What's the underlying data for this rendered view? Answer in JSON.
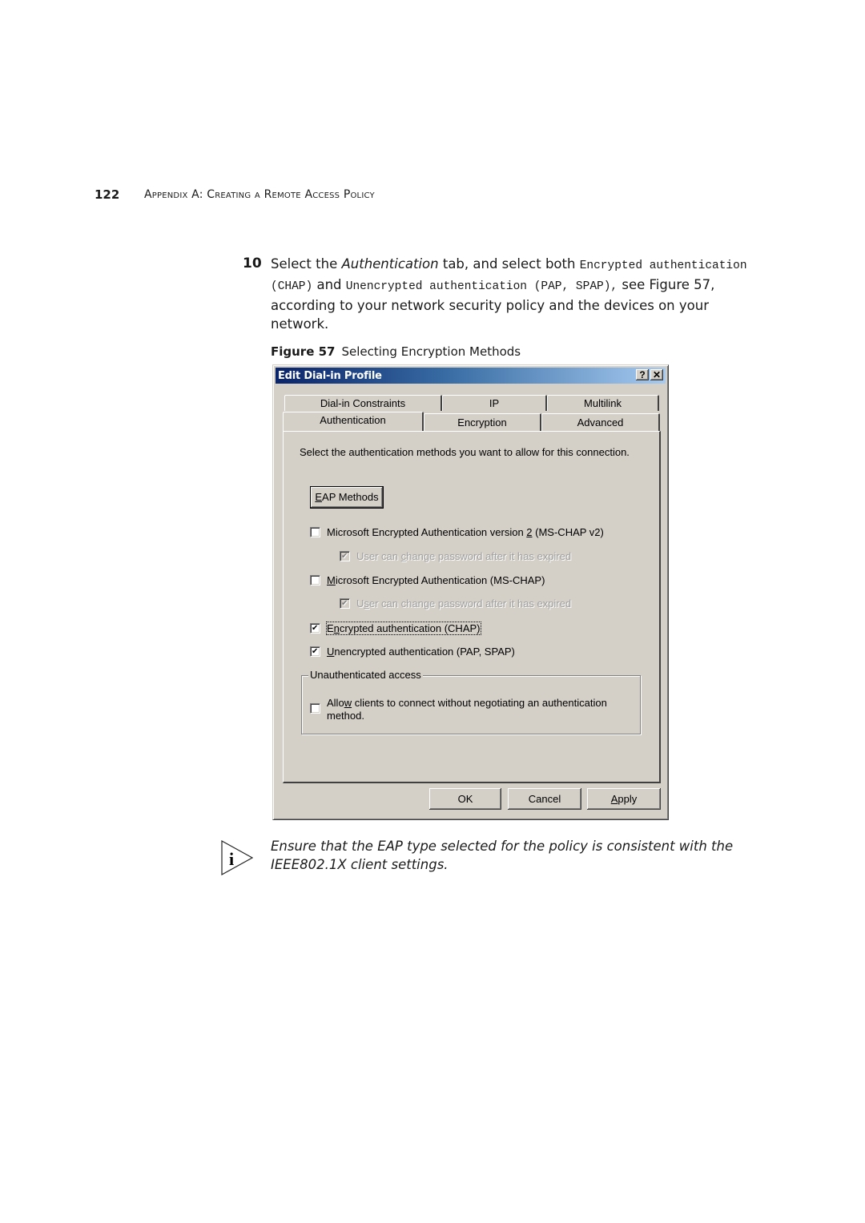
{
  "running_header": {
    "page_number": "122",
    "title": "Appendix A: Creating a Remote Access Policy"
  },
  "step": {
    "number": "10",
    "text_1": "Select the ",
    "text_italic": "Authentication",
    "text_2": " tab, and select both ",
    "mono_1": "Encrypted authentication (CHAP)",
    "text_3": " and ",
    "mono_2": "Unencrypted authentication (PAP, SPAP),",
    "text_4": "  see Figure 57, according to your network security policy and the devices on your network."
  },
  "figure": {
    "label": "Figure 57",
    "caption": "Selecting Encryption Methods"
  },
  "dialog": {
    "title": "Edit Dial-in Profile",
    "help_button": "?",
    "close_button": "✕",
    "tabs_back_row": [
      "Dial-in Constraints",
      "IP",
      "Multilink"
    ],
    "tabs_front_row": [
      "Authentication",
      "Encryption",
      "Advanced"
    ],
    "active_tab": "Authentication",
    "description": "Select the authentication methods you want to allow for this connection.",
    "eap_button": {
      "mnemonic": "E",
      "rest": "AP Methods"
    },
    "options": [
      {
        "pre": "Microsoft Encrypted Authentication version ",
        "mnemonic": "2",
        "post": " (MS-CHAP v2)",
        "checked": false,
        "enabled": true
      },
      {
        "pre": "User can ",
        "mnemonic": "c",
        "post": "hange password after it has expired",
        "checked": true,
        "enabled": false
      },
      {
        "pre": "",
        "mnemonic": "M",
        "post": "icrosoft Encrypted Authentication (MS-CHAP)",
        "checked": false,
        "enabled": true
      },
      {
        "pre": "U",
        "mnemonic": "s",
        "post": "er can change password after it has expired",
        "checked": true,
        "enabled": false
      },
      {
        "pre": "E",
        "mnemonic": "n",
        "post": "crypted authentication (CHAP)",
        "checked": true,
        "enabled": true
      },
      {
        "pre": "",
        "mnemonic": "U",
        "post": "nencrypted authentication (PAP, SPAP)",
        "checked": true,
        "enabled": true
      }
    ],
    "unauth_group": {
      "legend": "Unauthenticated access",
      "option": {
        "pre": "Allo",
        "mnemonic": "w",
        "post": " clients to connect without negotiating an authentication method.",
        "checked": false
      }
    },
    "buttons": {
      "ok": "OK",
      "cancel": "Cancel",
      "apply_mnemonic": "A",
      "apply_rest": "pply"
    }
  },
  "note": {
    "icon": "info-icon",
    "text": "Ensure that the EAP type selected for the policy is consistent with the IEEE802.1X client settings."
  }
}
